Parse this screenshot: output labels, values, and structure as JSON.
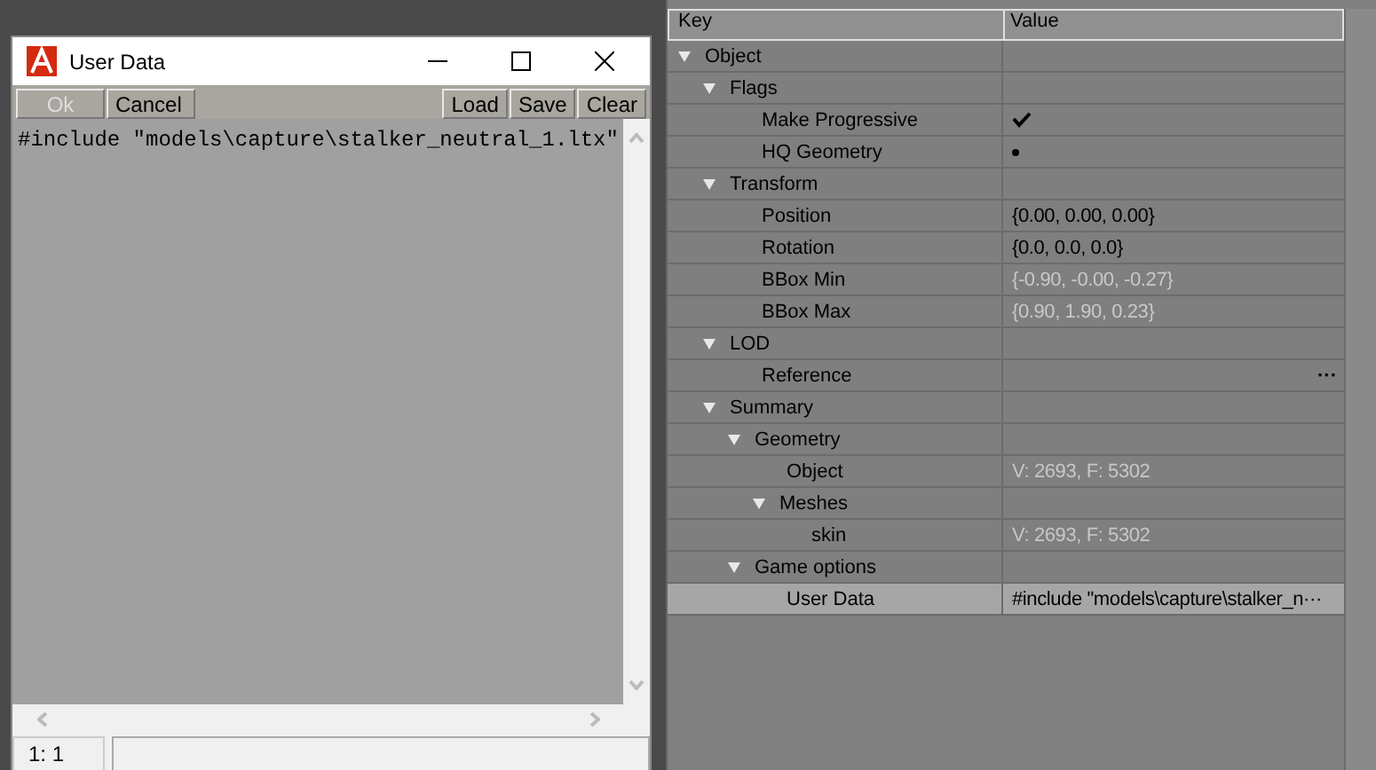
{
  "dialog": {
    "title": "User Data",
    "toolbar": [
      {
        "label": "Ok",
        "disabled": true
      },
      {
        "label": "Cancel",
        "disabled": false
      },
      {
        "label": "Load",
        "disabled": false
      },
      {
        "label": "Save",
        "disabled": false
      },
      {
        "label": "Clear",
        "disabled": false
      }
    ],
    "text": "#include \"models\\capture\\stalker_neutral_1.ltx\"",
    "status_position": "1: 1"
  },
  "properties": {
    "columns": [
      "Key",
      "Value"
    ],
    "rows": [
      {
        "label": "Object",
        "expanded": true,
        "selected": false,
        "children": [
          {
            "label": "Flags",
            "expanded": true,
            "selected": false,
            "children": [
              {
                "label": "Make Progressive",
                "kind": "check",
                "checked": true,
                "selected": false
              },
              {
                "label": "HQ Geometry",
                "kind": "dot",
                "checked": true,
                "selected": false
              }
            ]
          },
          {
            "label": "Transform",
            "expanded": true,
            "selected": false,
            "children": [
              {
                "label": "Position",
                "kind": "text",
                "value": "{0.00, 0.00, 0.00}",
                "readonly": false,
                "selected": false
              },
              {
                "label": "Rotation",
                "kind": "text",
                "value": "{0.0, 0.0, 0.0}",
                "readonly": false,
                "selected": false
              },
              {
                "label": "BBox Min",
                "kind": "text",
                "value": "{-0.90, -0.00, -0.27}",
                "readonly": true,
                "selected": false
              },
              {
                "label": "BBox Max",
                "kind": "text",
                "value": "{0.90, 1.90, 0.23}",
                "readonly": true,
                "selected": false
              }
            ]
          },
          {
            "label": "LOD",
            "expanded": true,
            "selected": false,
            "children": [
              {
                "label": "Reference",
                "kind": "button",
                "value": "···",
                "selected": false
              }
            ]
          },
          {
            "label": "Summary",
            "expanded": true,
            "selected": false,
            "children": [
              {
                "label": "Geometry",
                "expanded": true,
                "selected": false,
                "children": [
                  {
                    "label": "Object",
                    "kind": "text",
                    "value": "V: 2693, F: 5302",
                    "readonly": true,
                    "selected": false
                  },
                  {
                    "label": "Meshes",
                    "expanded": true,
                    "selected": false,
                    "children": [
                      {
                        "label": "skin",
                        "kind": "text",
                        "value": "V: 2693, F: 5302",
                        "readonly": true,
                        "selected": false
                      }
                    ]
                  }
                ]
              },
              {
                "label": "Game options",
                "expanded": true,
                "selected": false,
                "children": [
                  {
                    "label": "User Data",
                    "kind": "text",
                    "value": "#include \"models\\capture\\stalker_n···",
                    "readonly": false,
                    "selected": true
                  }
                ]
              }
            ]
          }
        ]
      }
    ]
  }
}
